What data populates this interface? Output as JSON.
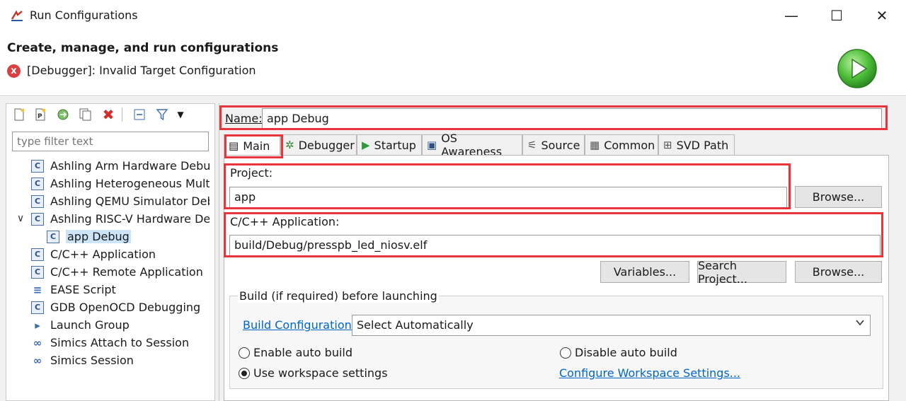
{
  "window": {
    "title": "Run Configurations",
    "minimize_glyph": "—",
    "maximize_glyph": "☐",
    "close_glyph": "✕"
  },
  "header": {
    "title": "Create, manage, and run configurations",
    "error_message": "[Debugger]: Invalid Target Configuration",
    "error_icon": "x"
  },
  "toolbar": {
    "icons": [
      "new-config-icon",
      "new-prototype-icon",
      "export-icon",
      "duplicate-icon",
      "delete-icon",
      "collapse-all-icon",
      "filter-icon",
      "menu-chevron-icon"
    ]
  },
  "filter": {
    "placeholder": "type filter text"
  },
  "tree": {
    "items": [
      {
        "label": "Ashling Arm Hardware Debugg",
        "icon": "C",
        "indent": 0
      },
      {
        "label": "Ashling Heterogeneous Multic",
        "icon": "C",
        "indent": 0
      },
      {
        "label": "Ashling QEMU Simulator Debu",
        "icon": "C",
        "indent": 0
      },
      {
        "label": "Ashling RISC-V Hardware Debu",
        "icon": "C",
        "indent": 0,
        "expanded": true
      },
      {
        "label": "app Debug",
        "icon": "C",
        "indent": 1,
        "selected": true
      },
      {
        "label": "C/C++ Application",
        "icon": "C",
        "indent": 0
      },
      {
        "label": "C/C++ Remote Application",
        "icon": "C",
        "indent": 0
      },
      {
        "label": "EASE Script",
        "icon": "≡",
        "indent": 0
      },
      {
        "label": "GDB OpenOCD Debugging",
        "icon": "C",
        "indent": 0
      },
      {
        "label": "Launch Group",
        "icon": "▸",
        "indent": 0
      },
      {
        "label": "Simics Attach to Session",
        "icon": "∞",
        "indent": 0
      },
      {
        "label": "Simics Session",
        "icon": "∞",
        "indent": 0
      }
    ],
    "expand_glyph": "∨"
  },
  "name_field": {
    "label": "Name:",
    "value": "app Debug"
  },
  "tabs": [
    {
      "label": "Main",
      "icon": "▤",
      "active": true
    },
    {
      "label": "Debugger",
      "icon": "✲"
    },
    {
      "label": "Startup",
      "icon": "▶"
    },
    {
      "label": "OS Awareness",
      "icon": "▣"
    },
    {
      "label": "Source",
      "icon": "⚟"
    },
    {
      "label": "Common",
      "icon": "▦"
    },
    {
      "label": "SVD Path",
      "icon": "⊞"
    }
  ],
  "main_tab": {
    "project_label": "Project:",
    "project_value": "app",
    "browse_label": "Browse...",
    "app_label": "C/C++ Application:",
    "app_value": "build/Debug/presspb_led_niosv.elf",
    "variables_label": "Variables...",
    "search_project_label": "Search Project...",
    "browse2_label": "Browse...",
    "build_group_title": "Build (if required) before launching",
    "build_config_link": "Build Configuration:",
    "build_config_value": "Select Automatically",
    "enable_auto_build": "Enable auto build",
    "disable_auto_build": "Disable auto build",
    "use_workspace": "Use workspace settings",
    "configure_link": "Configure Workspace Settings...",
    "selected_radio": "use_workspace"
  },
  "colors": {
    "accent_red": "#e8343a",
    "link": "#0066cc",
    "selection": "#cce4f7",
    "run_green": "#3aa53a"
  }
}
